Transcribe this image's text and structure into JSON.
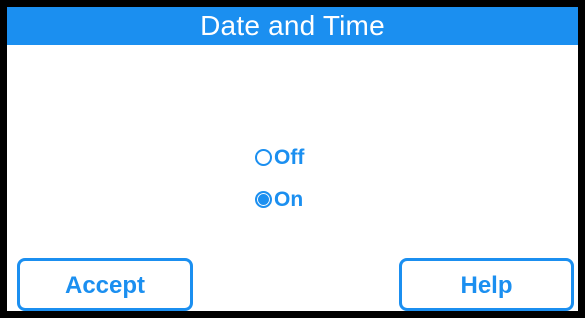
{
  "header": {
    "title": "Date and Time"
  },
  "options": [
    {
      "label": "Off",
      "selected": false
    },
    {
      "label": "On",
      "selected": true
    }
  ],
  "buttons": {
    "accept_label": "Accept",
    "help_label": "Help"
  },
  "colors": {
    "accent": "#1b8ff0",
    "background": "#ffffff",
    "frame": "#000000"
  },
  "icons": {
    "radio_unselected": "radio-unselected-icon",
    "radio_selected": "radio-selected-icon"
  }
}
